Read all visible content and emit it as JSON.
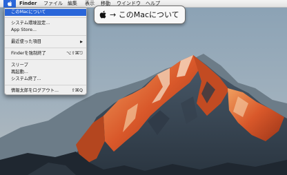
{
  "menubar": {
    "apple_icon": "apple-logo-icon",
    "app_name": "Finder",
    "items": [
      "ファイル",
      "編集",
      "表示",
      "移動",
      "ウインドウ",
      "ヘルプ"
    ]
  },
  "apple_menu": {
    "items": [
      {
        "label": "このMacについて",
        "shortcut": "",
        "selected": true
      },
      {
        "label": "システム環境設定...",
        "shortcut": ""
      },
      {
        "label": "App Store...",
        "shortcut": ""
      },
      {
        "label": "最近使った項目",
        "shortcut": "▶"
      },
      {
        "label": "Finderを強制終了",
        "shortcut": "⌥⇧⌘⎋"
      },
      {
        "label": "スリープ",
        "shortcut": ""
      },
      {
        "label": "再起動...",
        "shortcut": ""
      },
      {
        "label": "システム終了...",
        "shortcut": ""
      },
      {
        "label": "情報太郎をログアウト...",
        "shortcut": "⇧⌘Q"
      }
    ]
  },
  "callout": {
    "icon": "apple-logo-icon",
    "text": "→ このMacについて"
  },
  "colors": {
    "selection": "#2a66d9",
    "sky_top": "#879fb3",
    "mountain_glow": "#d8582a",
    "rock_dark": "#3e4a57"
  }
}
